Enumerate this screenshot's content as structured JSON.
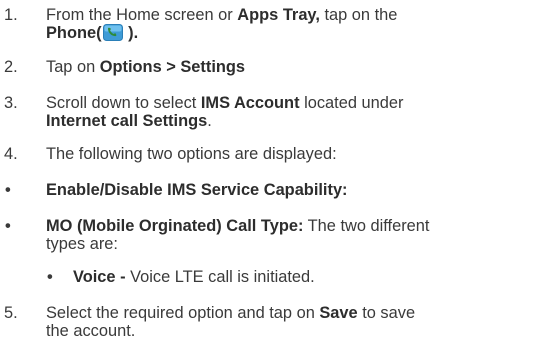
{
  "steps": [
    {
      "marker": "1.",
      "t1": "From the Home screen or ",
      "b1": "Apps Tray,",
      "t2": " tap on the",
      "b2": "Phone",
      "t3": "(",
      "icon": "phone-app-icon",
      "t4": " )."
    },
    {
      "marker": "2.",
      "t1": "Tap on ",
      "b1": "Options > Settings"
    },
    {
      "marker": "3.",
      "t1": "Scroll down to select ",
      "b1": "IMS Account",
      "t2": " located under",
      "b2": "Internet call Settings",
      "t3": "."
    },
    {
      "marker": "4.",
      "t1": "The following two options are displayed:"
    },
    {
      "marker": "•",
      "b1": "Enable/Disable IMS Service Capability:"
    },
    {
      "marker": "•",
      "b1": "MO (Mobile Orginated) Call Type:",
      "t1": " The two different",
      "t2": "types are:"
    },
    {
      "marker": "•",
      "b1": "Voice -",
      "t1": " Voice LTE call is initiated."
    },
    {
      "marker": "5.",
      "t1": "Select the required option and tap on ",
      "b1": "Save",
      "t2": " to save",
      "t3": "the account."
    }
  ],
  "colors": {
    "text": "#3a3a3a",
    "phone_icon_bg": "#3e9bd6",
    "phone_icon_handset": "#2e8b3a"
  }
}
